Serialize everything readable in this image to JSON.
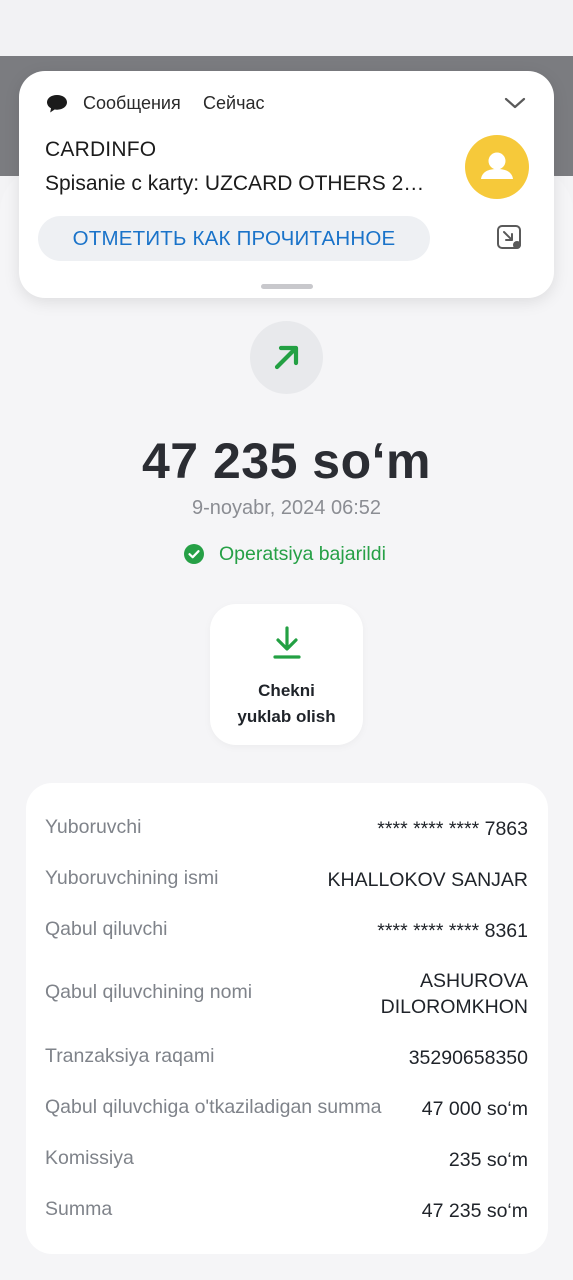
{
  "notification": {
    "app_name": "Сообщения",
    "time": "Сейчас",
    "title": "CARDINFO",
    "body": "Spisanie c karty: UZCARD OTHERS 2…",
    "action_label": "ОТМЕТИТЬ КАК ПРОЧИТАННОЕ",
    "avatar_color": "#f6c93a",
    "action_color": "#1a73c9"
  },
  "transaction": {
    "direction_icon": "arrow-up-right-icon",
    "amount": "47 235 so‘m",
    "datetime": "9-noyabr, 2024 06:52",
    "status": "Operatsiya bajarildi",
    "status_color": "#26a046"
  },
  "receipt_button": {
    "label": "Chekni\nyuklab olish",
    "icon": "download-icon"
  },
  "details": [
    {
      "label": "Yuboruvchi",
      "value": "**** **** **** 7863"
    },
    {
      "label": "Yuboruvchining ismi",
      "value": "KHALLOKOV SANJAR"
    },
    {
      "label": "Qabul qiluvchi",
      "value": "**** **** **** 8361"
    },
    {
      "label": "Qabul qiluvchining nomi",
      "value": "ASHUROVA\nDILOROMKHON"
    },
    {
      "label": "Tranzaksiya raqami",
      "value": "35290658350"
    },
    {
      "label": "Qabul qiluvchiga o'tkaziladigan summa",
      "value": "47 000 so‘m"
    },
    {
      "label": "Komissiya",
      "value": "235 so‘m"
    },
    {
      "label": "Summa",
      "value": "47 235 so‘m"
    }
  ]
}
